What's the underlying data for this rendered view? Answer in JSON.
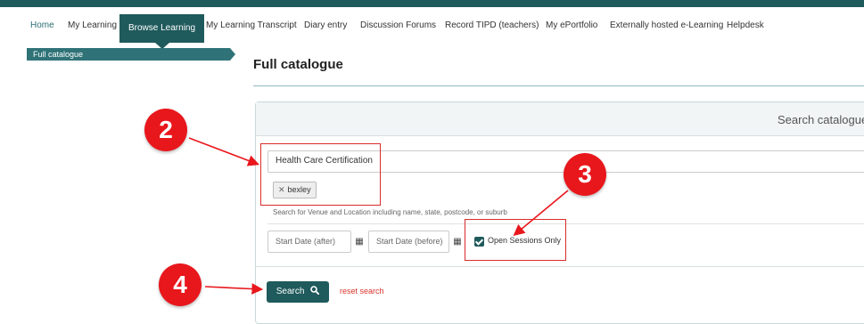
{
  "nav": {
    "items": [
      {
        "label": "Home"
      },
      {
        "label": "My Learning"
      },
      {
        "label": "Browse Learning"
      },
      {
        "label": "My Learning Transcript"
      },
      {
        "label": "Diary entry"
      },
      {
        "label": "Discussion Forums"
      },
      {
        "label": "Record TIPD (teachers)"
      },
      {
        "label": "My ePortfolio"
      },
      {
        "label": "Externally hosted e-Learning"
      },
      {
        "label": "Helpdesk"
      }
    ],
    "active": "Browse Learning"
  },
  "sidebar": {
    "item": "Full catalogue"
  },
  "page": {
    "title": "Full catalogue"
  },
  "search_panel": {
    "title": "Search catalogue",
    "query_value": "Health Care Certification",
    "location_tag": "bexley",
    "location_placeholder": "Search for Venue and Location including name, state, postcode, or suburb",
    "start_after_placeholder": "Start Date (after)",
    "start_before_placeholder": "Start Date (before)",
    "open_sessions_label": "Open Sessions Only",
    "open_sessions_checked": true,
    "search_button": "Search",
    "reset_link": "reset search"
  },
  "annotations": {
    "badge_2": "2",
    "badge_3": "3",
    "badge_4": "4"
  },
  "colors": {
    "brand": "#1f5a5c",
    "annotation_red": "#e8171c",
    "reset_link": "#d9342b"
  }
}
